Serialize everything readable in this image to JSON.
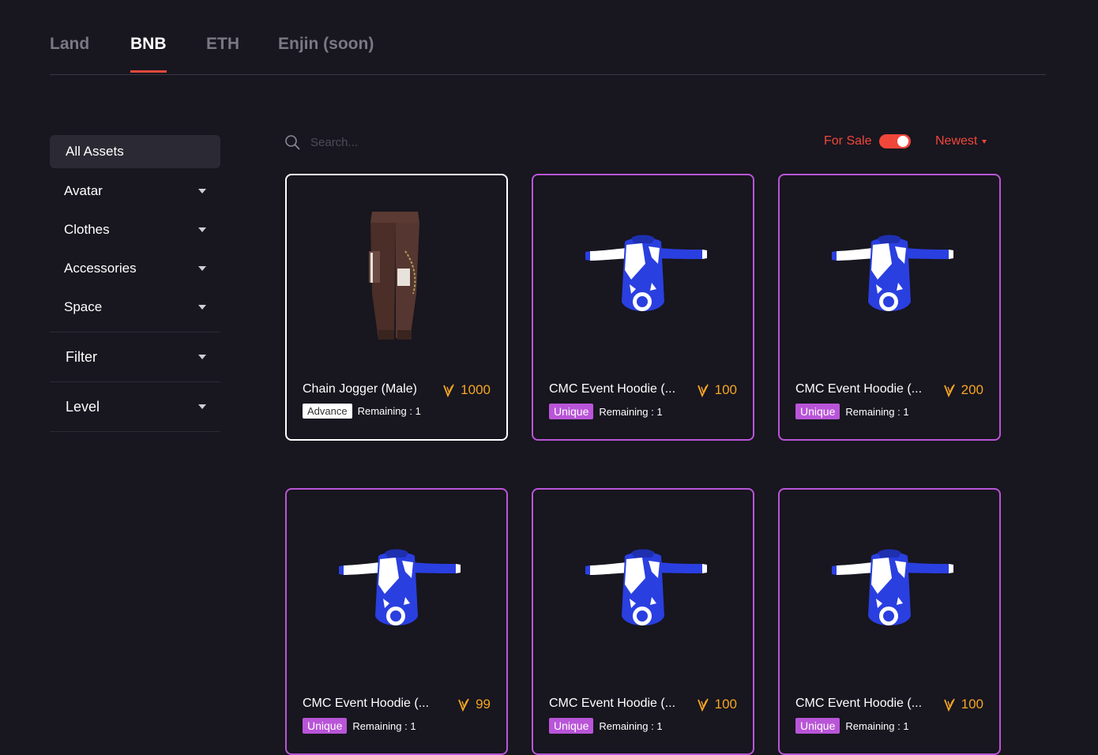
{
  "tabs": [
    {
      "label": "Land",
      "active": false
    },
    {
      "label": "BNB",
      "active": true
    },
    {
      "label": "ETH",
      "active": false
    },
    {
      "label": "Enjin (soon)",
      "active": false
    }
  ],
  "sidebar": {
    "all_label": "All Assets",
    "items": [
      {
        "label": "Avatar"
      },
      {
        "label": "Clothes"
      },
      {
        "label": "Accessories"
      },
      {
        "label": "Space"
      }
    ],
    "filter_label": "Filter",
    "level_label": "Level"
  },
  "search": {
    "placeholder": "Search..."
  },
  "toolbar": {
    "for_sale_label": "For Sale",
    "for_sale_on": true,
    "sort_label": "Newest"
  },
  "colors": {
    "accent": "#f0473a",
    "unique": "#b955d8",
    "price": "#f5a623",
    "background": "#18161f"
  },
  "cards": [
    {
      "name": "Chain Jogger (Male)",
      "price": "1000",
      "rarity": "Advance",
      "remaining": "Remaining : 1",
      "item": "joggers-image"
    },
    {
      "name": "CMC Event Hoodie (...",
      "price": "100",
      "rarity": "Unique",
      "remaining": "Remaining : 1",
      "item": "hoodie-image"
    },
    {
      "name": "CMC Event Hoodie (...",
      "price": "200",
      "rarity": "Unique",
      "remaining": "Remaining : 1",
      "item": "hoodie-image"
    },
    {
      "name": "CMC Event Hoodie (...",
      "price": "99",
      "rarity": "Unique",
      "remaining": "Remaining : 1",
      "item": "hoodie-image"
    },
    {
      "name": "CMC Event Hoodie (...",
      "price": "100",
      "rarity": "Unique",
      "remaining": "Remaining : 1",
      "item": "hoodie-image"
    },
    {
      "name": "CMC Event Hoodie (...",
      "price": "100",
      "rarity": "Unique",
      "remaining": "Remaining : 1",
      "item": "hoodie-image"
    }
  ]
}
